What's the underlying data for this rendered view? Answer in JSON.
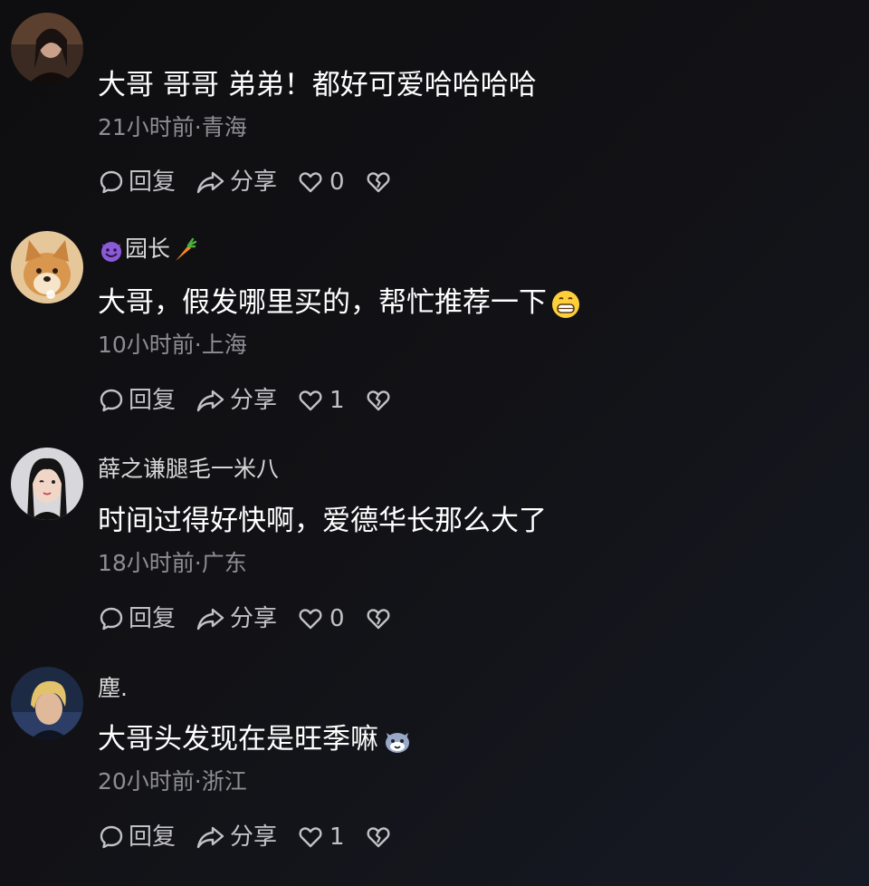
{
  "comments": [
    {
      "username": "",
      "text": "大哥 哥哥 弟弟！都好可爱哈哈哈哈",
      "meta": "21小时前·青海",
      "reply_label": "回复",
      "share_label": "分享",
      "like_count": "0",
      "avatar_icon": "avatar-woman-dark-photo"
    },
    {
      "username": "园长",
      "username_badges": [
        "smiling-devil-emoji",
        "carrot-emoji"
      ],
      "text": "大哥，假发哪里买的，帮忙推荐一下",
      "text_emoji": "grinning-face-emoji",
      "meta": "10小时前·上海",
      "reply_label": "回复",
      "share_label": "分享",
      "like_count": "1",
      "avatar_icon": "avatar-shiba-dog"
    },
    {
      "username": "薛之谦腿毛一米八",
      "text": "时间过得好快啊，爱德华长那么大了",
      "meta": "18小时前·广东",
      "reply_label": "回复",
      "share_label": "分享",
      "like_count": "0",
      "avatar_icon": "avatar-woman-winking"
    },
    {
      "username": "塵.",
      "text": "大哥头发现在是旺季嘛",
      "text_emoji": "cat-face-emoji",
      "meta": "20小时前·浙江",
      "reply_label": "回复",
      "share_label": "分享",
      "like_count": "1",
      "avatar_icon": "avatar-man-blond"
    }
  ],
  "colors": {
    "background": "#121216",
    "username": "#d8d8d8",
    "meta": "#8d8d93",
    "actions": "#c2c2c6"
  }
}
